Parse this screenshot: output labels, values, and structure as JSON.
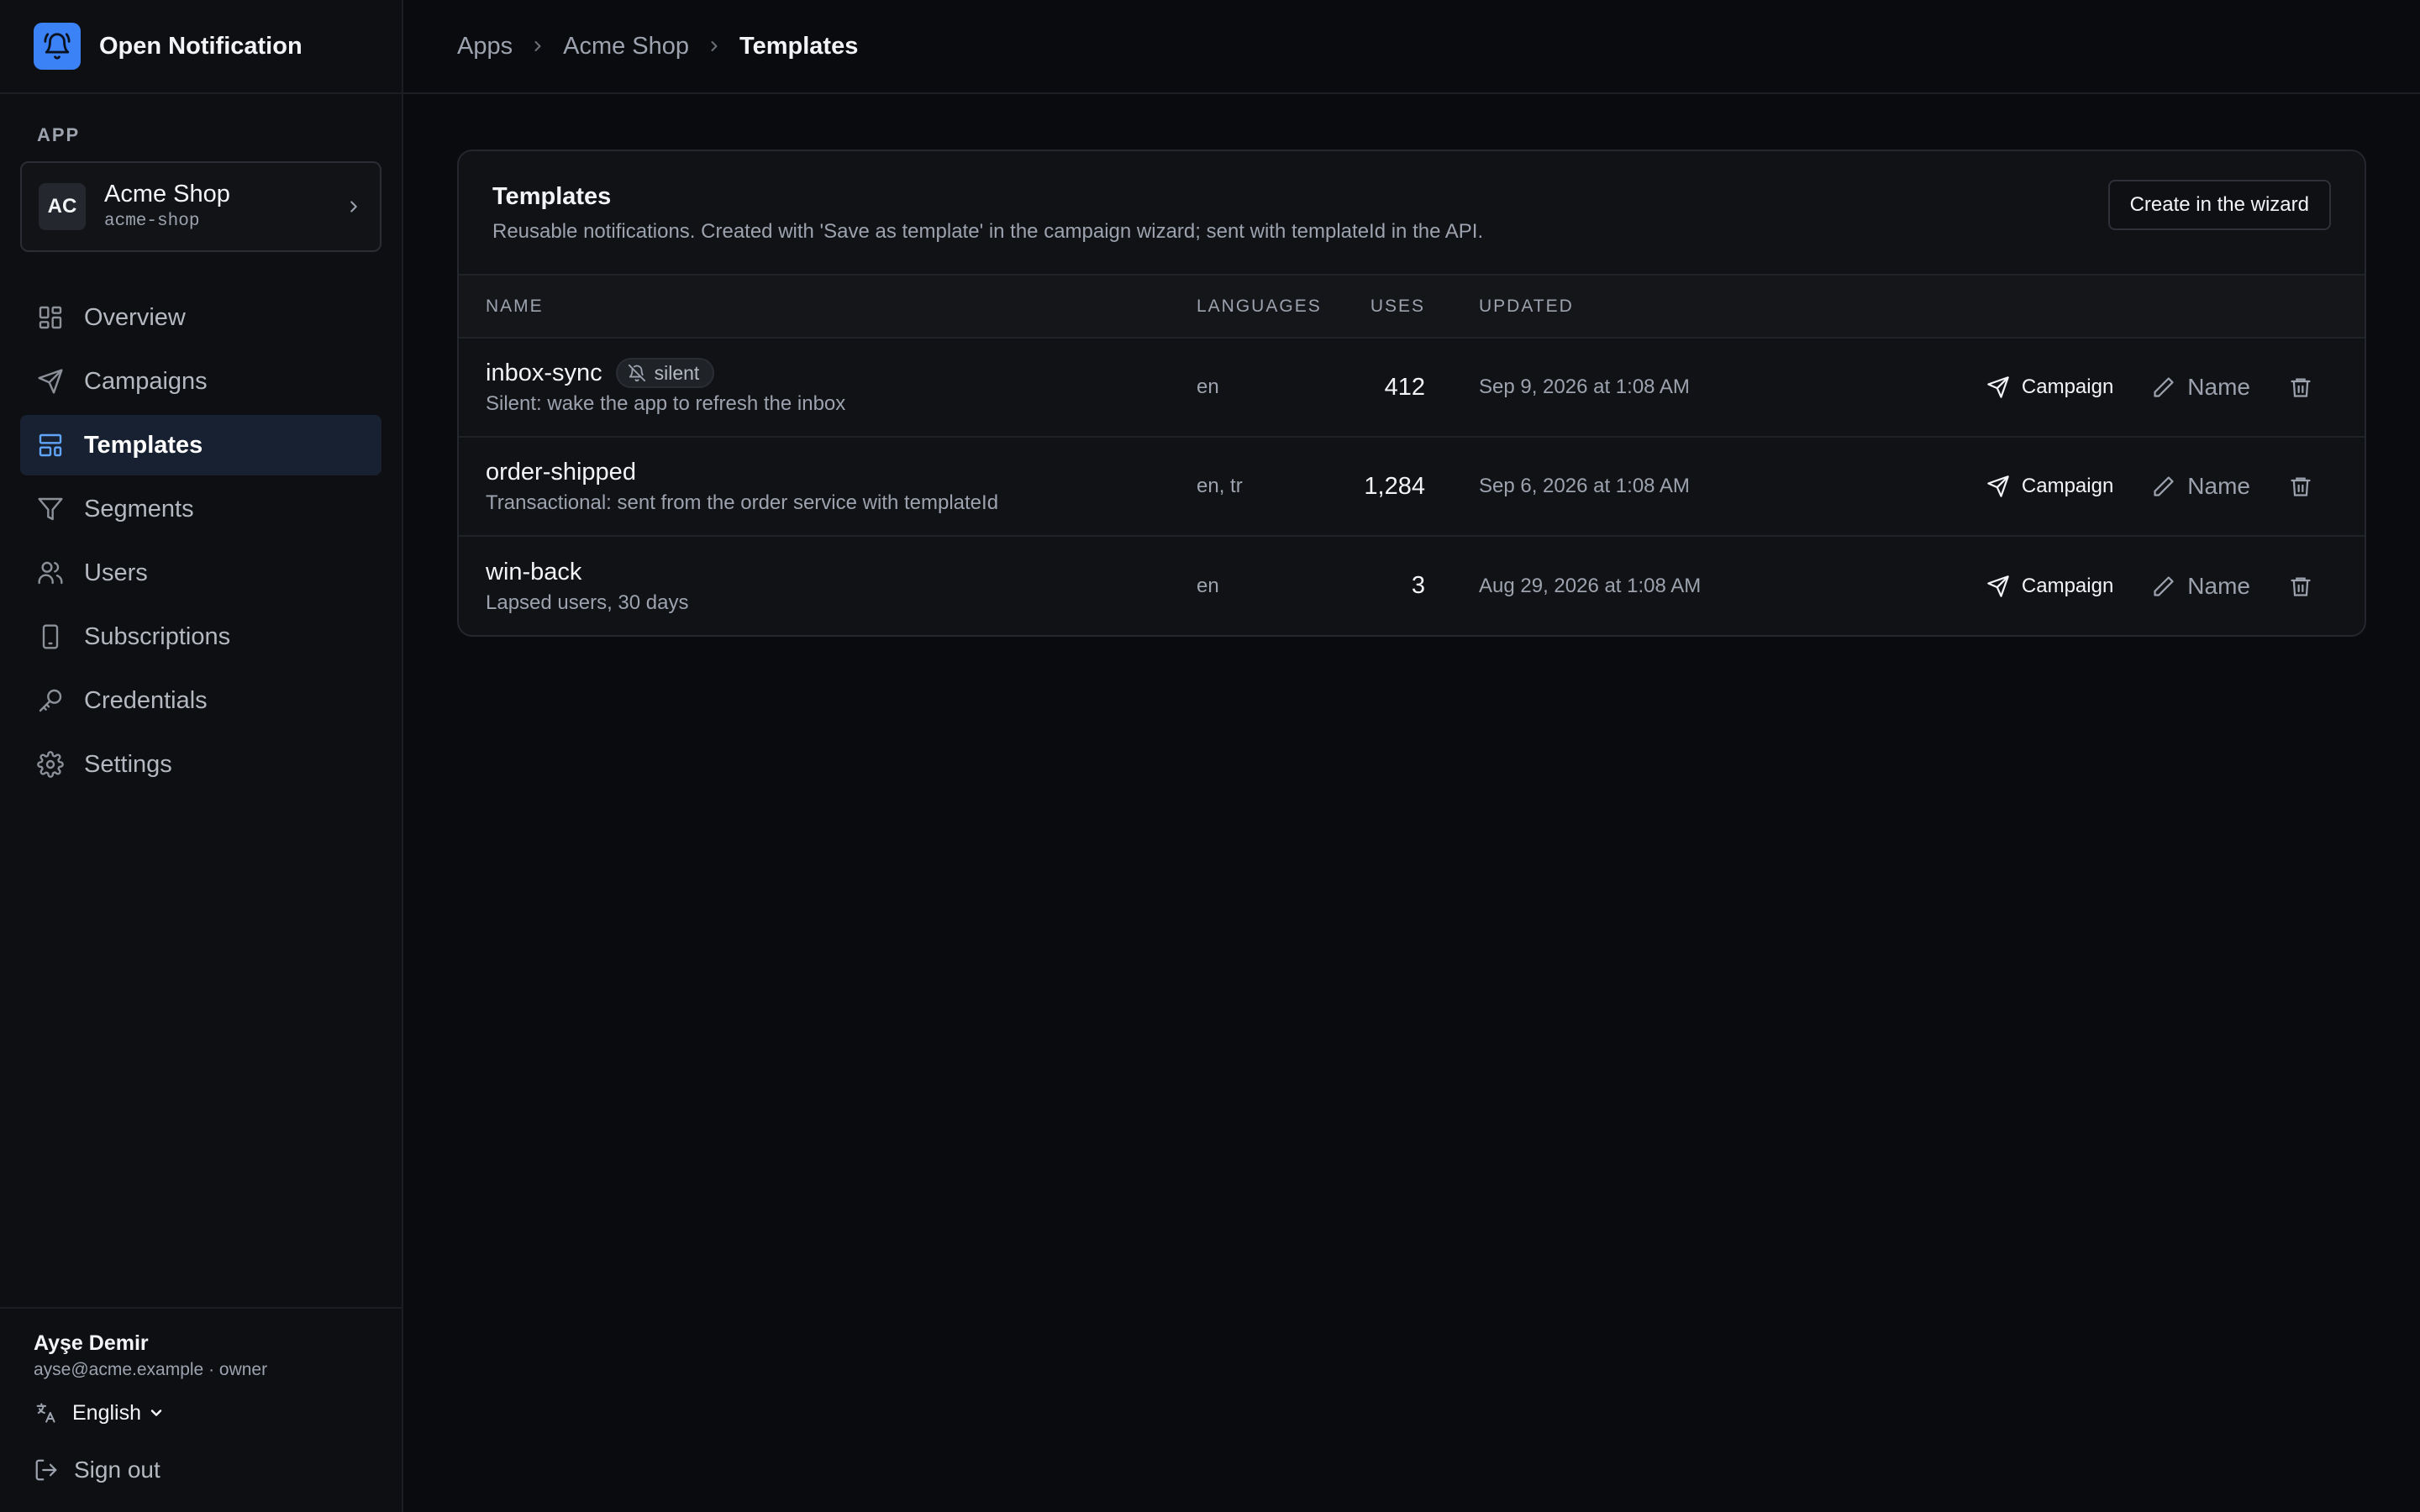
{
  "brand": {
    "name": "Open Notification",
    "icon": "bell-icon"
  },
  "sidebar": {
    "section_label": "APP",
    "app": {
      "initials": "AC",
      "name": "Acme Shop",
      "slug": "acme-shop"
    },
    "nav": [
      {
        "label": "Overview",
        "icon": "overview-icon"
      },
      {
        "label": "Campaigns",
        "icon": "send-icon"
      },
      {
        "label": "Templates",
        "icon": "template-icon",
        "active": true
      },
      {
        "label": "Segments",
        "icon": "filter-icon"
      },
      {
        "label": "Users",
        "icon": "users-icon"
      },
      {
        "label": "Subscriptions",
        "icon": "device-icon"
      },
      {
        "label": "Credentials",
        "icon": "key-icon"
      },
      {
        "label": "Settings",
        "icon": "gear-icon"
      }
    ],
    "footer": {
      "user_name": "Ayşe Demir",
      "user_email": "ayse@acme.example · owner",
      "language": "English",
      "sign_out": "Sign out"
    }
  },
  "breadcrumb": [
    "Apps",
    "Acme Shop",
    "Templates"
  ],
  "card": {
    "title": "Templates",
    "description": "Reusable notifications. Created with 'Save as template' in the campaign wizard; sent with templateId in the API.",
    "create_button": "Create in the wizard"
  },
  "table": {
    "headers": {
      "name": "NAME",
      "languages": "LANGUAGES",
      "uses": "USES",
      "updated": "UPDATED"
    },
    "rows": [
      {
        "name": "inbox-sync",
        "badge": "silent",
        "description": "Silent: wake the app to refresh the inbox",
        "languages": "en",
        "uses": "412",
        "updated": "Sep 9, 2026 at 1:08 AM"
      },
      {
        "name": "order-shipped",
        "badge": "",
        "description": "Transactional: sent from the order service with templateId",
        "languages": "en, tr",
        "uses": "1,284",
        "updated": "Sep 6, 2026 at 1:08 AM"
      },
      {
        "name": "win-back",
        "badge": "",
        "description": "Lapsed users, 30 days",
        "languages": "en",
        "uses": "3",
        "updated": "Aug 29, 2026 at 1:08 AM"
      }
    ],
    "actions": {
      "campaign": "Campaign",
      "name": "Name"
    }
  },
  "colors": {
    "accent": "#3b82f6",
    "background": "#0a0b0e",
    "active_nav": "#172131"
  }
}
